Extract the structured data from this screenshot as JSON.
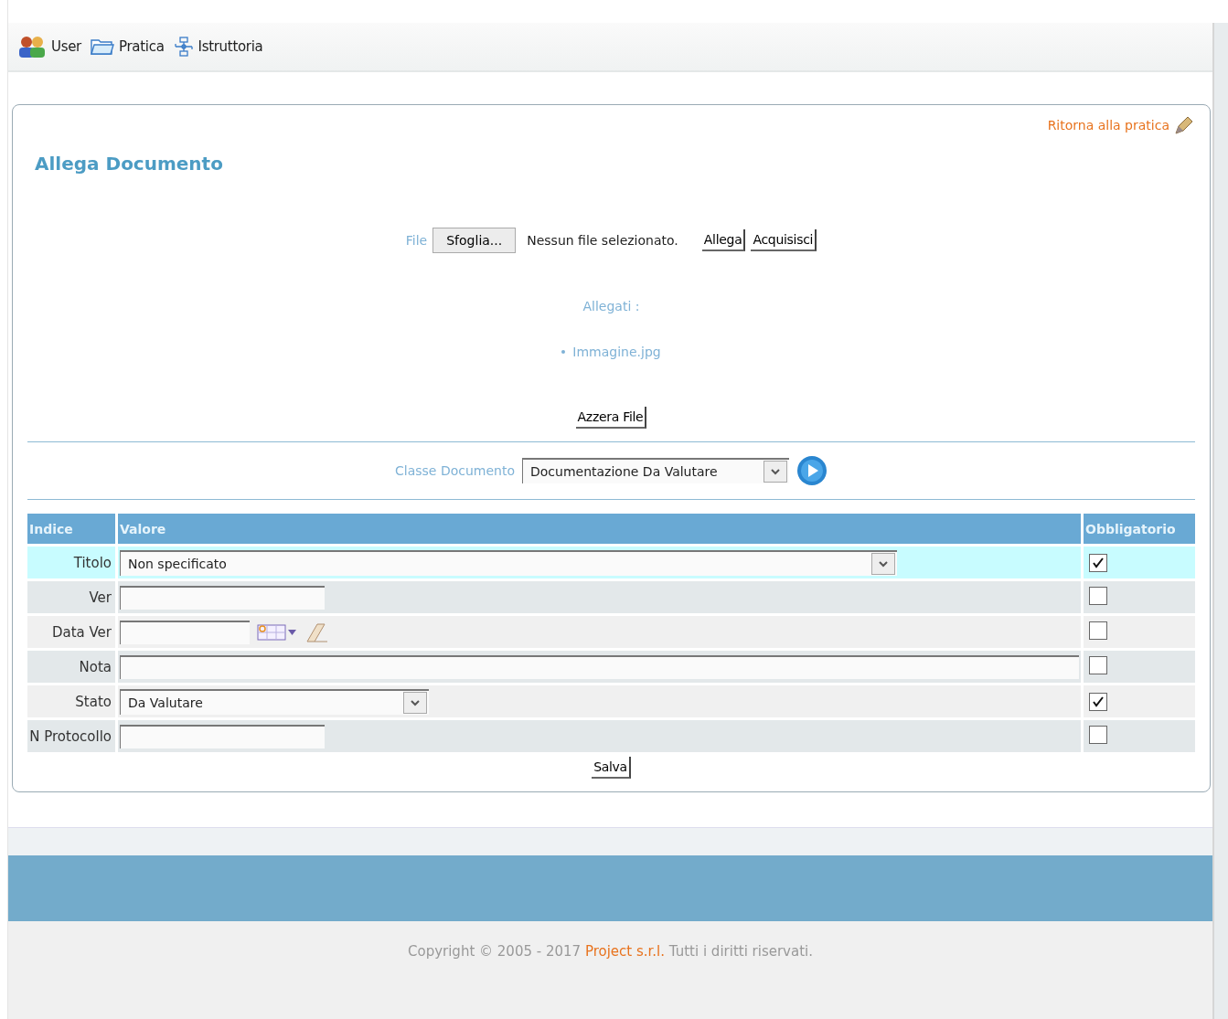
{
  "toolbar": {
    "items": [
      {
        "kind": "users",
        "label": "User"
      },
      {
        "kind": "folder",
        "label": "Pratica"
      },
      {
        "kind": "flow",
        "label": "Istruttoria"
      }
    ]
  },
  "card": {
    "back_link": "Ritorna alla pratica",
    "title": "Allega Documento",
    "file_label": "File",
    "browse_button": "Sfoglia...",
    "file_status": "Nessun file selezionato.",
    "attach_button": "Allega",
    "acquire_button": "Acquisisci",
    "attachments_label": "Allegati :",
    "attachments": [
      "Immagine.jpg"
    ],
    "reset_button": "Azzera File",
    "class_label": "Classe Documento",
    "class_value": "Documentazione Da Valutare"
  },
  "table": {
    "columns": [
      "Indice",
      "Valore",
      "Obbligatorio"
    ],
    "rows": [
      {
        "label": "Titolo",
        "kind": "combo",
        "value": "Non specificato",
        "required": true,
        "selected": true
      },
      {
        "label": "Ver",
        "kind": "text",
        "required": false,
        "selected": false
      },
      {
        "label": "Data Ver",
        "kind": "date",
        "required": false,
        "selected": false
      },
      {
        "label": "Nota",
        "kind": "memo",
        "required": false,
        "selected": false
      },
      {
        "label": "Stato",
        "kind": "select",
        "value": "Da Valutare",
        "required": true,
        "selected": false
      },
      {
        "label": "N Protocollo",
        "kind": "text",
        "required": false,
        "selected": false
      }
    ]
  },
  "save_button": "Salva",
  "footer": {
    "before": "Copyright © 2005 - 2017 ",
    "company": "Project s.r.l.",
    "after": " Tutti i diritti riservati."
  }
}
